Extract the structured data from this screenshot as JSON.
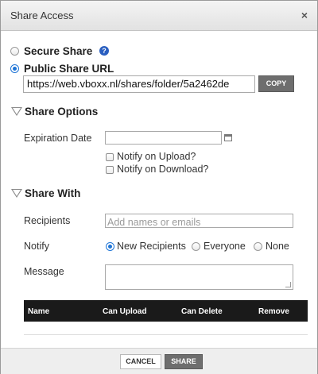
{
  "dialog": {
    "title": "Share Access",
    "close_glyph": "×"
  },
  "secure_share": {
    "label": "Secure Share",
    "help_glyph": "?"
  },
  "public_share": {
    "label": "Public Share URL",
    "url": "https://web.vboxx.nl/shares/folder/5a2462de",
    "copy_label": "COPY"
  },
  "share_options": {
    "heading": "Share Options",
    "expiration_label": "Expiration Date",
    "expiration_value": "",
    "notify_upload_label": "Notify on Upload?",
    "notify_download_label": "Notify on Download?"
  },
  "share_with": {
    "heading": "Share With",
    "recipients_label": "Recipients",
    "recipients_placeholder": "Add names or emails",
    "notify_label": "Notify",
    "notify_options": [
      "New Recipients",
      "Everyone",
      "None"
    ],
    "notify_selected": "New Recipients",
    "message_label": "Message",
    "message_value": ""
  },
  "table": {
    "columns": [
      "Name",
      "Can Upload",
      "Can Delete",
      "Remove"
    ]
  },
  "footer": {
    "cancel_label": "CANCEL",
    "share_label": "SHARE"
  },
  "colors": {
    "accent": "#1e74d6",
    "table_header": "#1a1a1a",
    "button_dark": "#6e6e6e"
  }
}
